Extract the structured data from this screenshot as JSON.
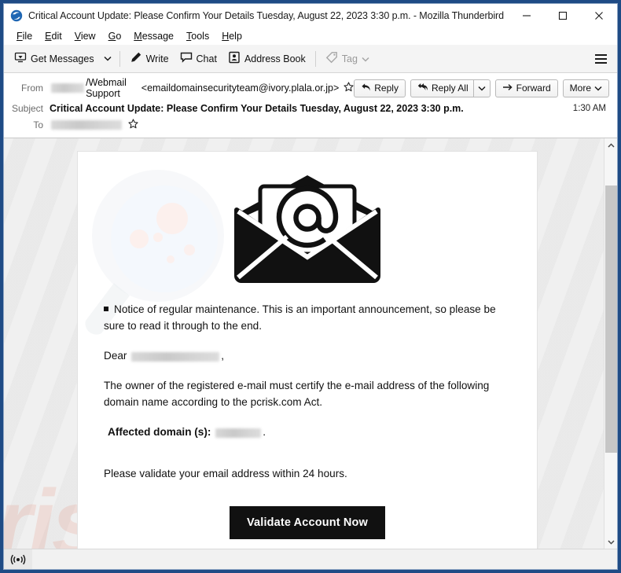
{
  "window": {
    "title": "Critical Account Update: Please Confirm Your Details Tuesday, August 22, 2023 3:30 p.m. - Mozilla Thunderbird",
    "app_icon": "thunderbird-icon",
    "controls": {
      "minimize": "minimize-icon",
      "maximize": "maximize-icon",
      "close": "close-icon"
    }
  },
  "menubar": {
    "items": [
      {
        "label": "File",
        "accel": "F",
        "rest": "ile"
      },
      {
        "label": "Edit",
        "accel": "E",
        "rest": "dit"
      },
      {
        "label": "View",
        "accel": "V",
        "rest": "iew"
      },
      {
        "label": "Go",
        "accel": "G",
        "rest": "o"
      },
      {
        "label": "Message",
        "accel": "M",
        "rest": "essage"
      },
      {
        "label": "Tools",
        "accel": "T",
        "rest": "ools"
      },
      {
        "label": "Help",
        "accel": "H",
        "rest": "elp"
      }
    ]
  },
  "toolbar": {
    "get_messages": "Get Messages",
    "write": "Write",
    "chat": "Chat",
    "address_book": "Address Book",
    "tag": "Tag",
    "app_menu": "app-menu-icon"
  },
  "message_header": {
    "from_label": "From",
    "from_sender_redacted": true,
    "from_name": "/Webmail Support",
    "from_address": "<emaildomainsecurityteam@ivory.plala.or.jp>",
    "subject_label": "Subject",
    "subject": "Critical Account Update: Please Confirm Your Details Tuesday, August 22, 2023 3:30 p.m.",
    "to_label": "To",
    "to_redacted": true,
    "timestamp": "1:30 AM",
    "actions": {
      "reply": "Reply",
      "reply_all": "Reply All",
      "forward": "Forward",
      "more": "More"
    }
  },
  "email_body": {
    "hero_image": "envelope-at-symbol-image",
    "notice": "Notice of regular maintenance. This is an important announcement, so please be sure to read it through to the end.",
    "greeting_prefix": "Dear",
    "greeting_redacted": true,
    "greeting_suffix": ",",
    "owner_paragraph": "The owner of the registered e-mail must certify the e-mail address of the following domain name according to the pcrisk.com Act.",
    "affected_label": "Affected domain (s):",
    "affected_redacted": true,
    "affected_suffix": ".",
    "validate_note": "Please validate your email address within 24 hours.",
    "cta_button": "Validate Account Now",
    "watermark_text": "risk.com"
  },
  "statusbar": {
    "connection_icon": "connection-status-icon"
  },
  "colors": {
    "window_border": "#1f4b85",
    "toolbar_bg": "#f4f4f4",
    "body_bg": "#f0f0f0",
    "cta_bg": "#111111",
    "cta_text": "#ffffff",
    "watermark": "#e8785c"
  }
}
